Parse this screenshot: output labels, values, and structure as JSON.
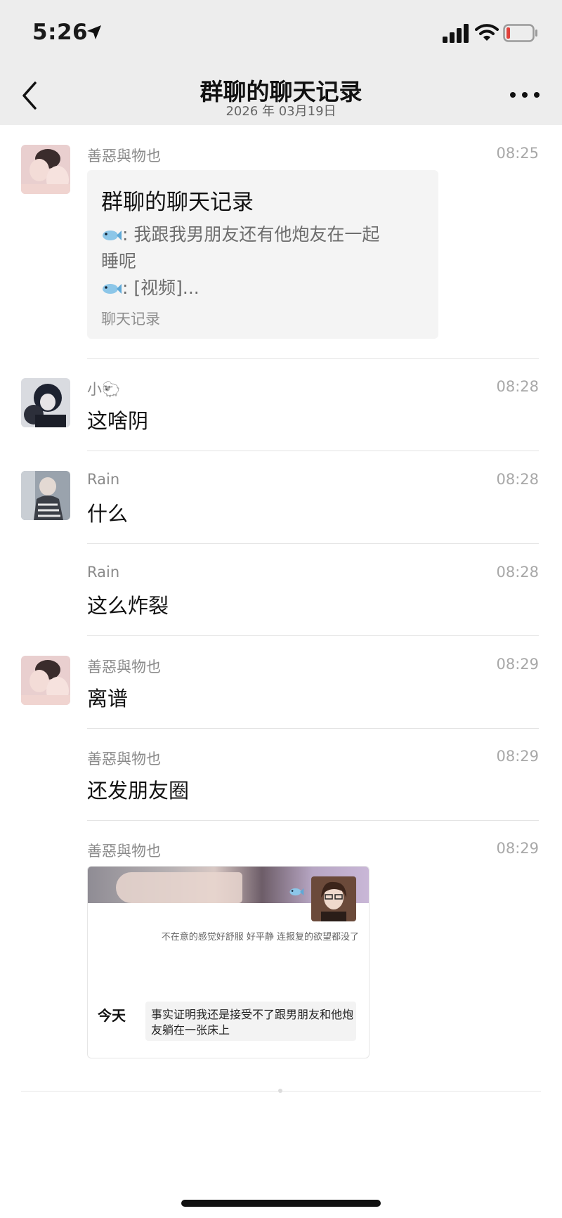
{
  "status_bar": {
    "time": "5:26"
  },
  "nav": {
    "title": "群聊的聊天记录",
    "subtitle": "2026 年 03月19日"
  },
  "messages": [
    {
      "sender": "善惡與物也",
      "time": "08:25",
      "record": {
        "title": "群聊的聊天记录",
        "line1": ": 我跟我男朋友还有他炮友在一起",
        "line2": "睡呢",
        "line3": ": [视频]...",
        "footer": "聊天记录"
      }
    },
    {
      "sender": "小🐑",
      "time": "08:28",
      "text": "这啥阴"
    },
    {
      "sender": "Rain",
      "time": "08:28",
      "text": "什么"
    },
    {
      "sender": "Rain",
      "time": "08:28",
      "text": "这么炸裂"
    },
    {
      "sender": "善惡與物也",
      "time": "08:29",
      "text": "离谱"
    },
    {
      "sender": "善惡與物也",
      "time": "08:29",
      "text": "还发朋友圈"
    },
    {
      "sender": "善惡與物也",
      "time": "08:29",
      "image_card": {
        "caption": "不在意的感觉好舒服 好平静 连报复的欲望都没了",
        "today_label": "今天",
        "quote": "事实证明我还是接受不了跟男朋友和他炮友躺在一张床上"
      }
    }
  ],
  "colors": {
    "nav_bg": "#ededed",
    "card_bg": "#f4f4f4",
    "battery_low": "#e0423c"
  },
  "icons": [
    "location-arrow-icon",
    "signal-icon",
    "wifi-icon",
    "battery-icon",
    "back-chevron-icon",
    "more-dots-icon",
    "fish-emoji-icon"
  ]
}
